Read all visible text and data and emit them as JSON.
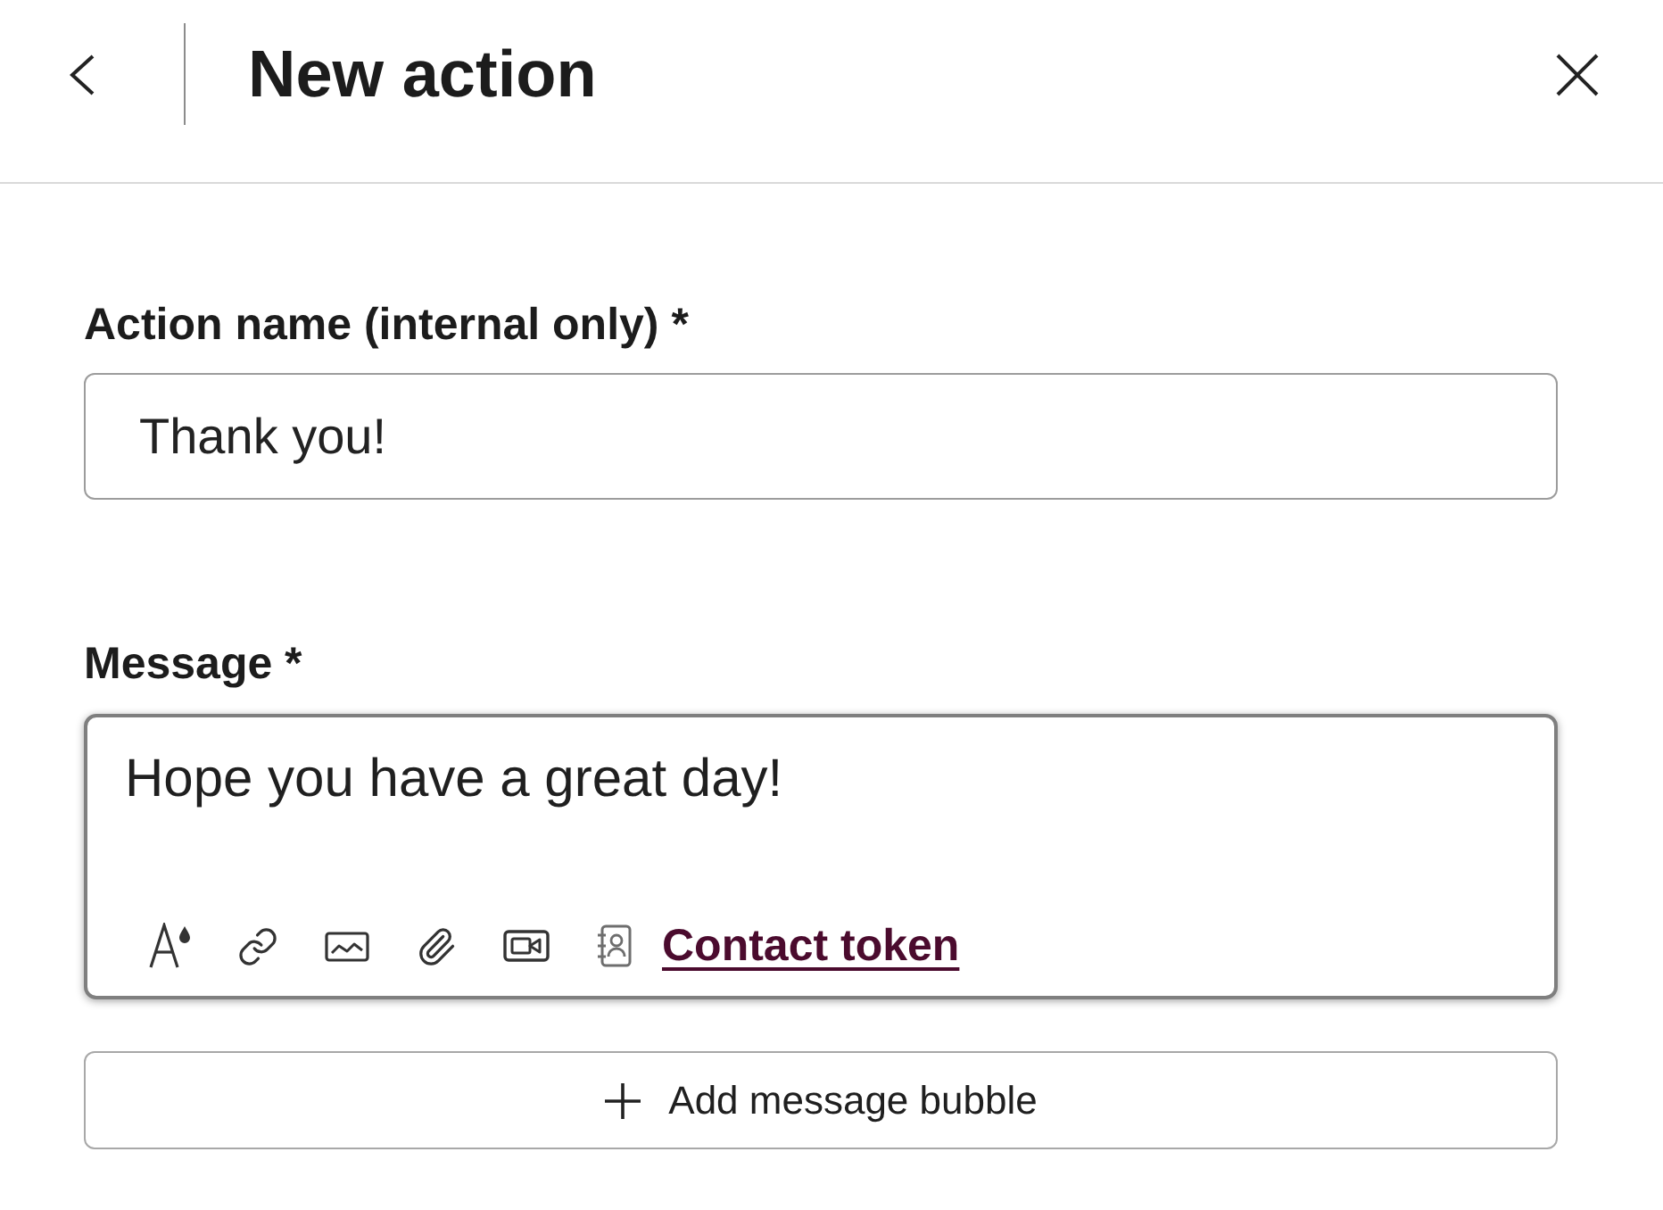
{
  "header": {
    "title": "New action"
  },
  "fields": [
    {
      "kind": "text",
      "label": "Action name (internal only) *",
      "value": "Thank you!",
      "focused": false
    },
    {
      "kind": "message",
      "label": "Message *",
      "value": "Hope you have a great day!",
      "focused": true,
      "token_link": "Contact token"
    }
  ],
  "add_button": {
    "label": "Add message bubble"
  }
}
